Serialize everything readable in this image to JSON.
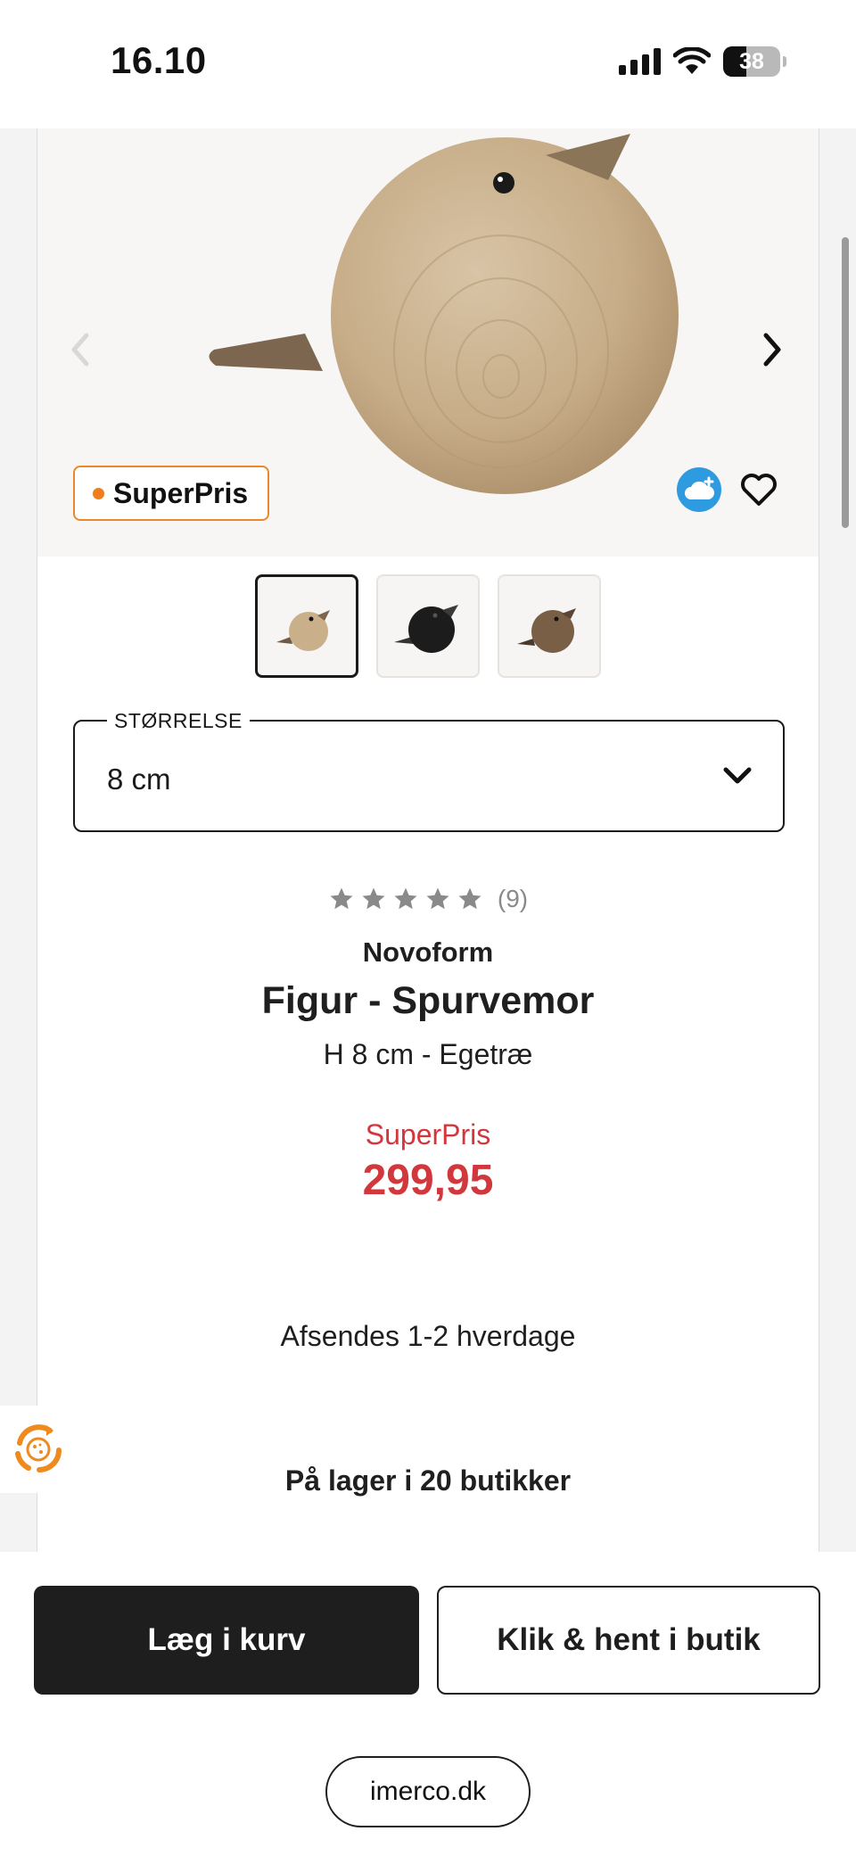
{
  "status_bar": {
    "time": "16.10",
    "battery_percent": "38",
    "icons": [
      "signal-icon",
      "wifi-icon",
      "battery-icon"
    ]
  },
  "product": {
    "badge": "SuperPris",
    "image_nav": {
      "prev_icon": "chevron-left-icon",
      "next_icon": "chevron-right-icon"
    },
    "actions": {
      "save_cloud_icon": "cloud-plus-icon",
      "favorite_icon": "heart-icon"
    },
    "thumbnails": [
      {
        "name": "oak-bird-thumbnail",
        "selected": true
      },
      {
        "name": "black-bird-thumbnail",
        "selected": false
      },
      {
        "name": "walnut-bird-thumbnail",
        "selected": false
      }
    ],
    "size": {
      "label": "STØRRELSE",
      "value": "8 cm"
    },
    "rating": {
      "stars": 5,
      "count": "(9)"
    },
    "brand": "Novoform",
    "title": "Figur - Spurvemor",
    "subtitle": "H 8 cm - Egetræ",
    "price_label": "SuperPris",
    "price": "299,95",
    "shipping": "Afsendes 1-2 hverdage",
    "stock": "På lager i 20 butikker"
  },
  "bottom_bar": {
    "add_to_cart": "Læg i kurv",
    "click_collect": "Klik & hent i butik",
    "url": "imerco.dk"
  },
  "colors": {
    "accent_orange": "#e8892b",
    "price_red": "#d1383e",
    "button_dark": "#1e1e1e",
    "cloud_blue": "#2e9be0"
  }
}
